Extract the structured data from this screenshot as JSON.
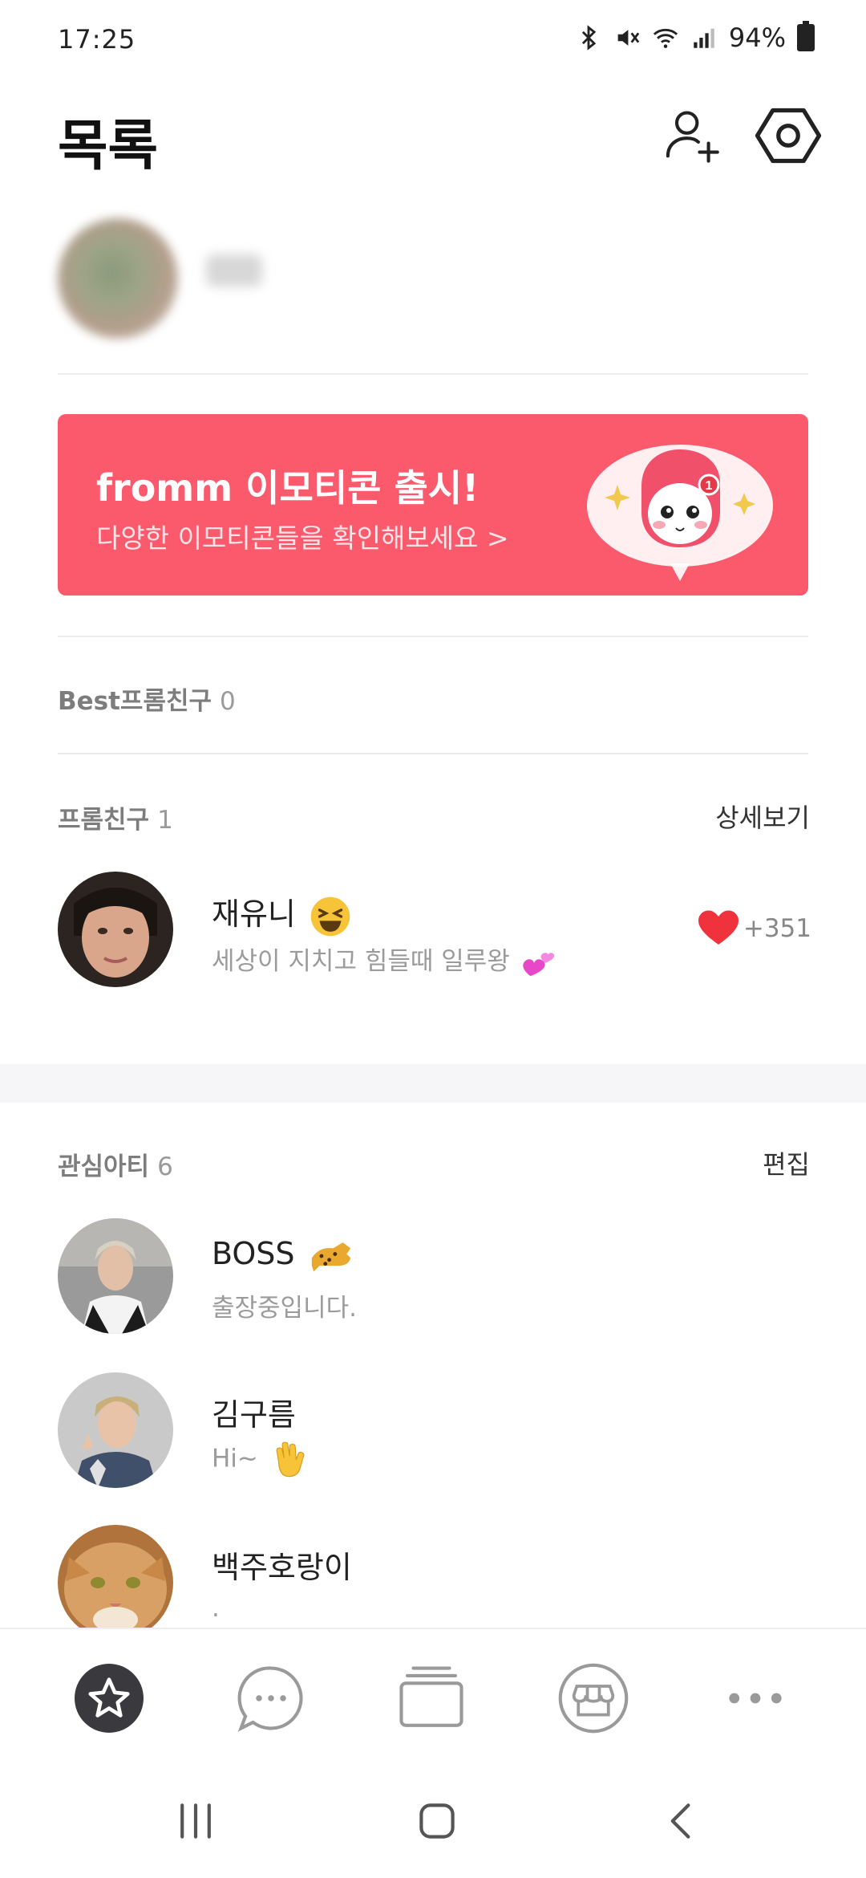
{
  "status_bar": {
    "time": "17:25",
    "battery": "94%"
  },
  "header": {
    "title": "목록"
  },
  "banner": {
    "title": "fromm 이모티콘 출시!",
    "subtitle": "다양한 이모티콘들을 확인해보세요 >",
    "badge": "1"
  },
  "best_section": {
    "label": "Best프롬친구",
    "count": "0"
  },
  "friends_section": {
    "label": "프롬친구",
    "count": "1",
    "action": "상세보기",
    "items": [
      {
        "name": "재유니",
        "status": "세상이 지치고 힘들때 일루왕",
        "likes": "+351"
      }
    ]
  },
  "interest_section": {
    "label": "관심아티",
    "count": "6",
    "action": "편집",
    "items": [
      {
        "name": "BOSS",
        "status": "출장중입니다."
      },
      {
        "name": "김구름",
        "status": "Hi~"
      },
      {
        "name": "백주호랑이",
        "status": "."
      }
    ]
  },
  "tabs": [
    {
      "icon": "star-icon",
      "active": true
    },
    {
      "icon": "chat-icon",
      "active": false
    },
    {
      "icon": "cards-icon",
      "active": false
    },
    {
      "icon": "store-icon",
      "active": false
    },
    {
      "icon": "more-icon",
      "active": false
    }
  ],
  "colors": {
    "banner": "#fb5a6d",
    "heart": "#f0323d",
    "active_tab": "#3a3a3e"
  }
}
